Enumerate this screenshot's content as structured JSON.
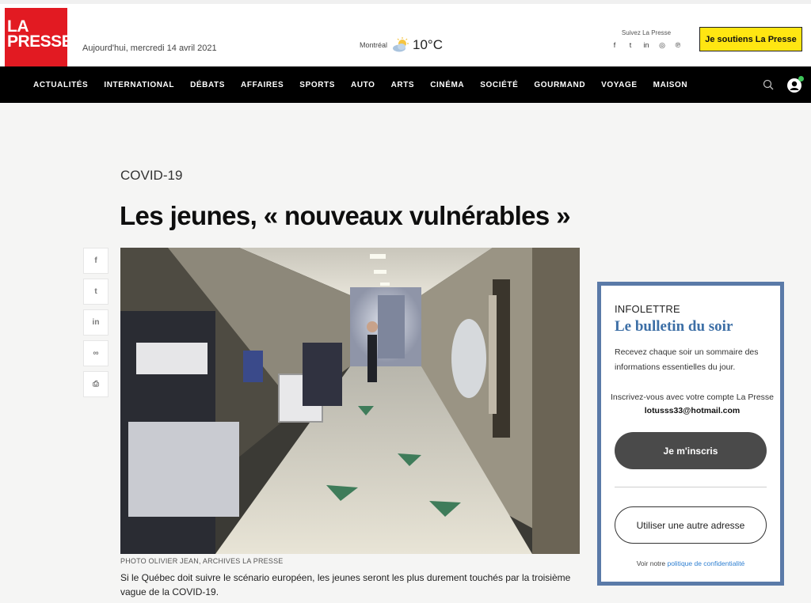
{
  "header": {
    "logo_line1": "LA",
    "logo_line2": "PRESSE",
    "date": "Aujourd'hui, mercredi 14 avril 2021",
    "weather": {
      "city": "Montréal",
      "temperature": "10°C",
      "icon": "partly-cloudy-icon"
    },
    "follow": {
      "label": "Suivez La Presse",
      "icons": [
        {
          "name": "facebook-icon",
          "glyph": "f"
        },
        {
          "name": "twitter-icon",
          "glyph": "t"
        },
        {
          "name": "linkedin-icon",
          "glyph": "in"
        },
        {
          "name": "instagram-icon",
          "glyph": "◎"
        },
        {
          "name": "pinterest-icon",
          "glyph": "℗"
        }
      ]
    },
    "support_button": "Je soutiens La Presse"
  },
  "nav": {
    "items": [
      "ACTUALITÉS",
      "INTERNATIONAL",
      "DÉBATS",
      "AFFAIRES",
      "SPORTS",
      "AUTO",
      "ARTS",
      "CINÉMA",
      "SOCIÉTÉ",
      "GOURMAND",
      "VOYAGE",
      "MAISON"
    ],
    "icons": [
      "search-icon",
      "user-account-icon"
    ]
  },
  "article": {
    "section": "COVID-19",
    "headline": "Les jeunes, « nouveaux vulnérables »",
    "share_icons": [
      {
        "name": "facebook-share-icon",
        "glyph": "f"
      },
      {
        "name": "twitter-share-icon",
        "glyph": "t"
      },
      {
        "name": "linkedin-share-icon",
        "glyph": "in"
      },
      {
        "name": "link-share-icon",
        "glyph": "∞"
      },
      {
        "name": "print-icon",
        "glyph": "⎙"
      }
    ],
    "photo_credit": "PHOTO OLIVIER JEAN, ARCHIVES LA PRESSE",
    "caption": "Si le Québec doit suivre le scénario européen, les jeunes seront les plus durement touchés par la troisième vague de la COVID-19."
  },
  "newsletter": {
    "label": "INFOLETTRE",
    "title": "Le bulletin du soir",
    "description": "Recevez chaque soir un sommaire des informations essentielles du jour.",
    "account_text": "Inscrivez-vous avec votre compte La Presse",
    "account_email": "lotusss33@hotmail.com",
    "subscribe_button": "Je m'inscris",
    "other_address_button": "Utiliser une autre adresse",
    "privacy_prefix": "Voir notre",
    "privacy_link": "politique de confidentialité"
  }
}
